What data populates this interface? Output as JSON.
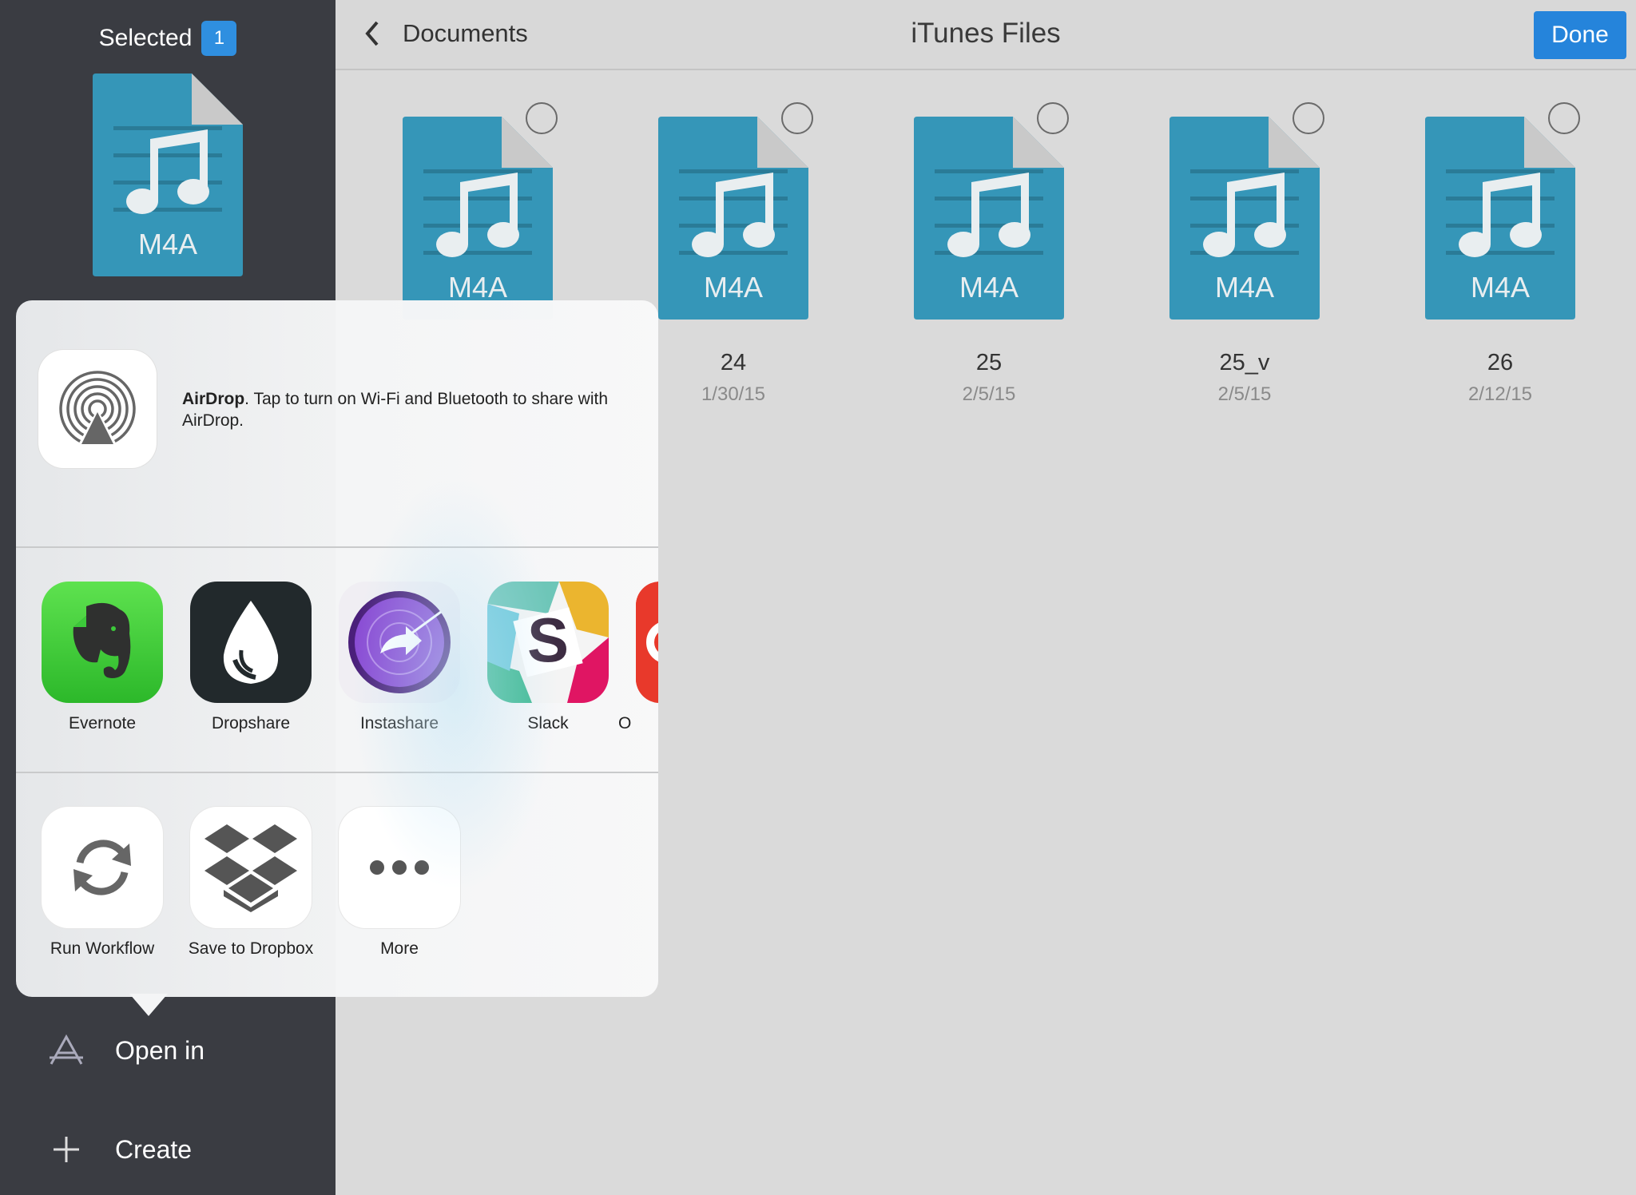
{
  "sidebar": {
    "selected_label": "Selected",
    "selected_count": "1",
    "thumb_type": "M4A",
    "actions": [
      {
        "label": "Open in",
        "icon": "app-store-icon"
      },
      {
        "label": "Create",
        "icon": "plus-icon"
      }
    ]
  },
  "topbar": {
    "back_label": "Documents",
    "title": "iTunes Files",
    "done_label": "Done"
  },
  "files": [
    {
      "type": "M4A",
      "name": "",
      "date": ""
    },
    {
      "type": "M4A",
      "name": "24",
      "date": "1/30/15"
    },
    {
      "type": "M4A",
      "name": "25",
      "date": "2/5/15"
    },
    {
      "type": "M4A",
      "name": "25_v",
      "date": "2/5/15"
    },
    {
      "type": "M4A",
      "name": "26",
      "date": "2/12/15"
    }
  ],
  "share": {
    "airdrop_title": "AirDrop",
    "airdrop_text": ". Tap to turn on Wi-Fi and Bluetooth to share with AirDrop.",
    "apps": [
      {
        "label": "Evernote",
        "icon": "evernote-icon"
      },
      {
        "label": "Dropshare",
        "icon": "dropshare-icon"
      },
      {
        "label": "Instashare",
        "icon": "instashare-icon"
      },
      {
        "label": "Slack",
        "icon": "slack-icon"
      },
      {
        "label": "O",
        "icon": "partial-app-icon"
      }
    ],
    "actions": [
      {
        "label": "Run Workflow",
        "icon": "workflow-icon"
      },
      {
        "label": "Save to Dropbox",
        "icon": "dropbox-icon"
      },
      {
        "label": "More",
        "icon": "more-icon"
      }
    ]
  },
  "colors": {
    "accent": "#2584db",
    "doc_blue": "#3596b8",
    "sidebar_bg": "#3a3c42"
  }
}
